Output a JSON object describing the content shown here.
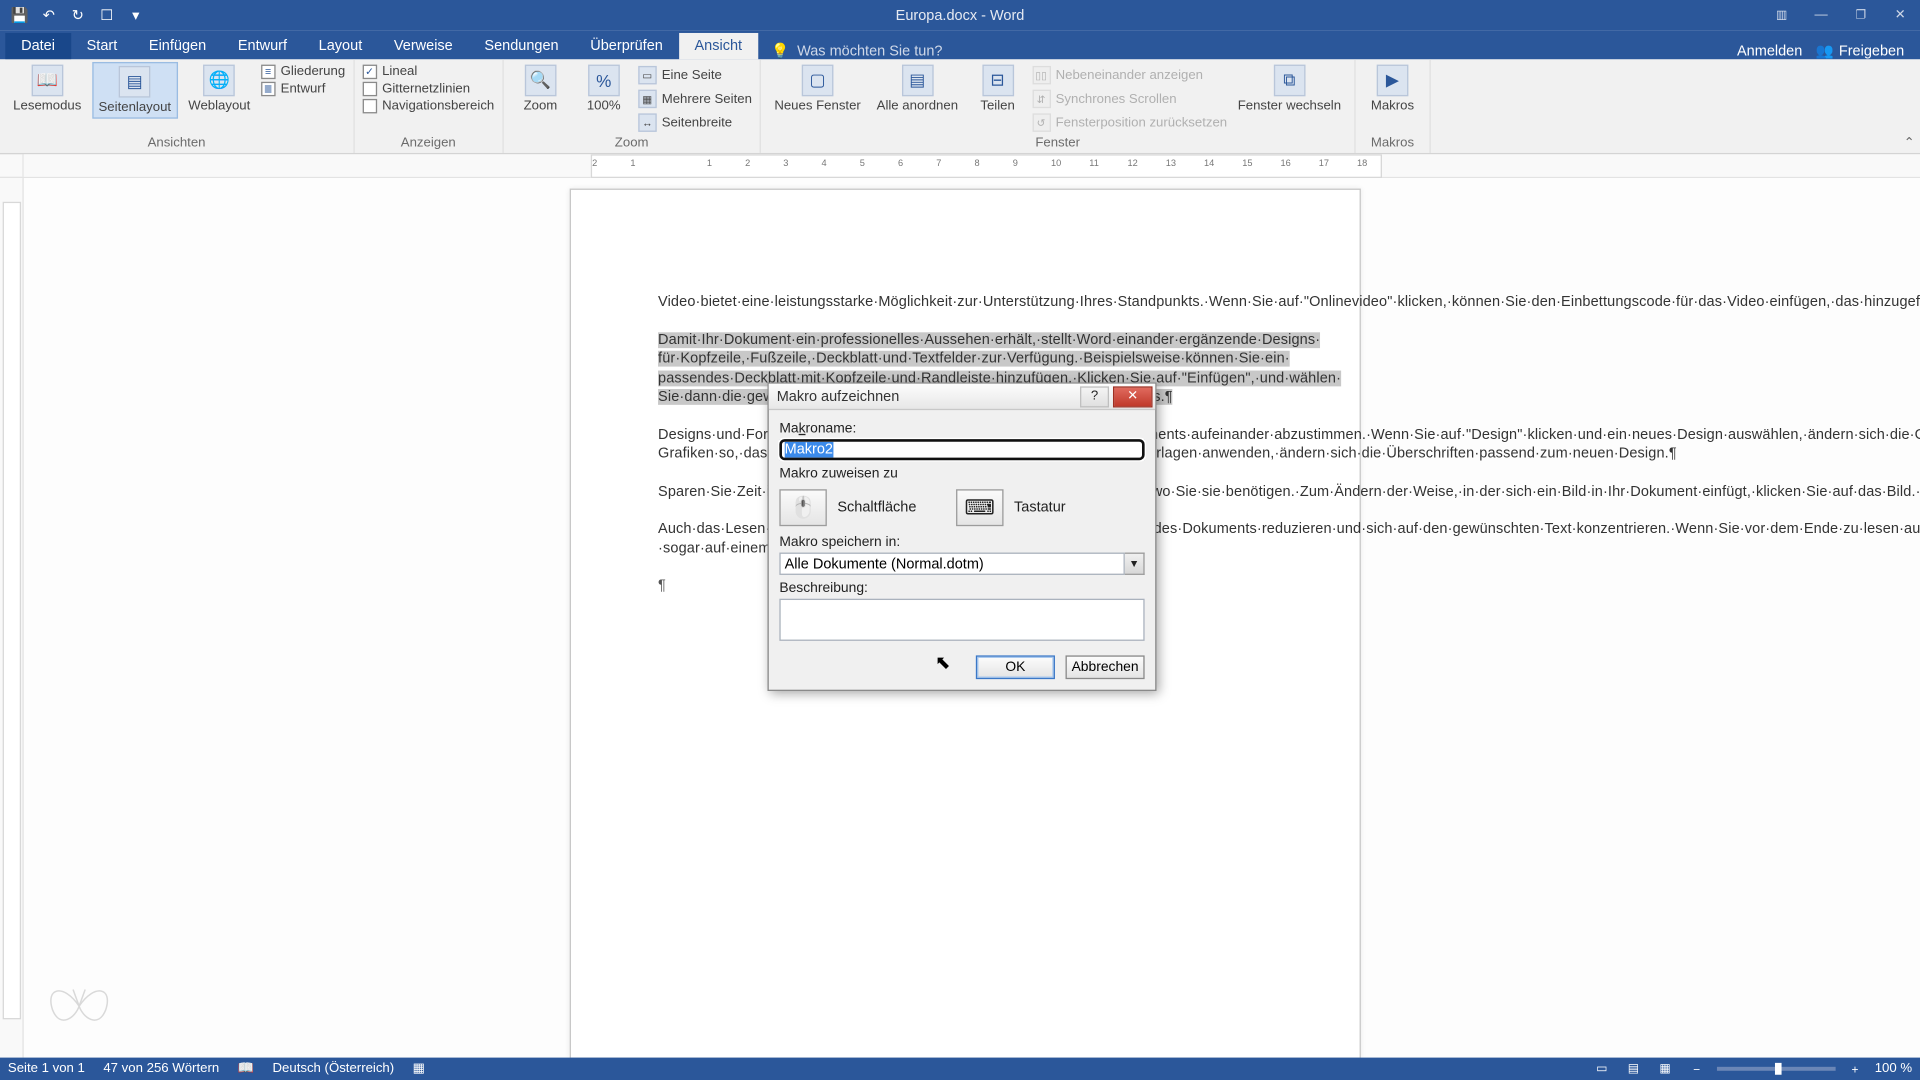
{
  "titlebar": {
    "doc_title": "Europa.docx - Word"
  },
  "tabs": {
    "file": "Datei",
    "list": [
      "Start",
      "Einfügen",
      "Entwurf",
      "Layout",
      "Verweise",
      "Sendungen",
      "Überprüfen",
      "Ansicht"
    ],
    "active_index": 7,
    "tell_me": "Was möchten Sie tun?",
    "sign_in": "Anmelden",
    "share": "Freigeben"
  },
  "ribbon": {
    "views": {
      "read": "Lesemodus",
      "print": "Seitenlayout",
      "web": "Weblayout",
      "outline": "Gliederung",
      "draft": "Entwurf",
      "group": "Ansichten"
    },
    "show": {
      "ruler": "Lineal",
      "gridlines": "Gitternetzlinien",
      "nav": "Navigationsbereich",
      "group": "Anzeigen"
    },
    "zoom": {
      "zoom": "Zoom",
      "p100": "100%",
      "one": "Eine Seite",
      "multi": "Mehrere Seiten",
      "width": "Seitenbreite",
      "group": "Zoom"
    },
    "window": {
      "new": "Neues Fenster",
      "all": "Alle anordnen",
      "split": "Teilen",
      "side": "Nebeneinander anzeigen",
      "sync": "Synchrones Scrollen",
      "reset": "Fensterposition zurücksetzen",
      "switch": "Fenster wechseln",
      "group": "Fenster"
    },
    "macros": {
      "macros": "Makros",
      "group": "Makros"
    }
  },
  "document": {
    "p1": "Video·bietet·eine·leistungsstarke·Möglichkeit·zur·Unterstützung·Ihres·Standpunkts.·Wenn·Sie·auf·\"Onlinevideo\"·klicken,·können·Sie·den·Einbettungscode·für·das·Video·einfügen,·das·hinzugefügt·werden·soll.·Sie·können·auch·ein·Stichwort·eingeben,·um·online·nach·dem·Videoclip·zu·suchen,·der·optimal·zu·Ihrem·Dokument·passt.¶",
    "p2a": "Damit·Ihr·Dokument·ein·professionelles·Aussehen·erhält,·stellt·Word·einander·ergänzende·Designs·",
    "p2b": "für·Kopfzeile,·Fußzeile,·Deckblatt·und·Textfelder·zur·Verfügung.·Beispielsweise·können·Sie·ein·",
    "p2c": "passendes·Deckblatt·mit·Kopfzeile·und·Randleiste·hinzufügen.·Klicken·Sie·auf·\"Einfügen\",·und·wählen·",
    "p2d": "Sie·dann·die·gewünschten·Elemente·aus·den·verschiedenen·Katalogen·aus.¶",
    "p3": "Designs·und·Formatvorlagen·helfen·auch·dabei,·die·Elemente·Ihres·Dokuments·aufeinander·abzustimmen.·Wenn·Sie·auf·\"Design\"·klicken·und·ein·neues·Design·auswählen,·ändern·sich·die·Grafiken,·Diagramme·und·SmartArt-Grafiken·so,·dass·sie·dem·neuen·Design·entsprechen.·Wenn·Sie·Formatvorlagen·anwenden,·ändern·sich·die·Überschriften·passend·zum·neuen·Design.¶",
    "p4": "Sparen·Sie·Zeit·in·Word·dank·neuer·Schaltflächen,·die·angezeigt·werden,·wo·Sie·sie·benötigen.·Zum·Ändern·der·Weise,·in·der·sich·ein·Bild·in·Ihr·Dokument·einfügt,·klicken·Sie·auf·das·Bild.·Dann·wird·eine·Schaltfläche·für·Layoutoptionen·neben·dem·Bild·angezeigt.·Beim·Arbeiten·an·einer·Tabelle·klicken·Sie·an·die·Position,·an·der·Sie·eine·Zeile·oder·Spalte·hinzufügen·möchten,·und·klicken·Sie·dann·auf·das·Pluszeichen.¶",
    "p5": "Auch·das·Lesen·ist·bequemer·in·der·neuen·Leseansicht.·Sie·können·Teile·des·Dokuments·reduzieren·und·sich·auf·den·gewünschten·Text·konzentrieren.·Wenn·Sie·vor·dem·Ende·zu·lesen·aufhören·müssen,·merkt·sich·Word·die·Stelle,·bis·zu·der·Sie·gelangt·sind·–·sogar·auf·einem·anderen·Gerät.¶"
  },
  "dialog": {
    "title": "Makro aufzeichnen",
    "name_label_pre": "Ma",
    "name_label_ul": "k",
    "name_label_post": "roname:",
    "name_value": "Makro2",
    "assign_label": "Makro zuweisen zu",
    "button_label": "Schaltfläche",
    "keyboard_label": "Tastatur",
    "store_label": "Makro speichern in:",
    "store_value": "Alle Dokumente (Normal.dotm)",
    "desc_label": "Beschreibung:",
    "ok": "OK",
    "cancel": "Abbrechen"
  },
  "status": {
    "page": "Seite 1 von 1",
    "words": "47 von 256 Wörtern",
    "lang": "Deutsch (Österreich)",
    "zoom": "100 %"
  },
  "ruler_numbers": [
    "2",
    "1",
    "",
    "1",
    "2",
    "3",
    "4",
    "5",
    "6",
    "7",
    "8",
    "9",
    "10",
    "11",
    "12",
    "13",
    "14",
    "15",
    "16",
    "17",
    "18"
  ]
}
